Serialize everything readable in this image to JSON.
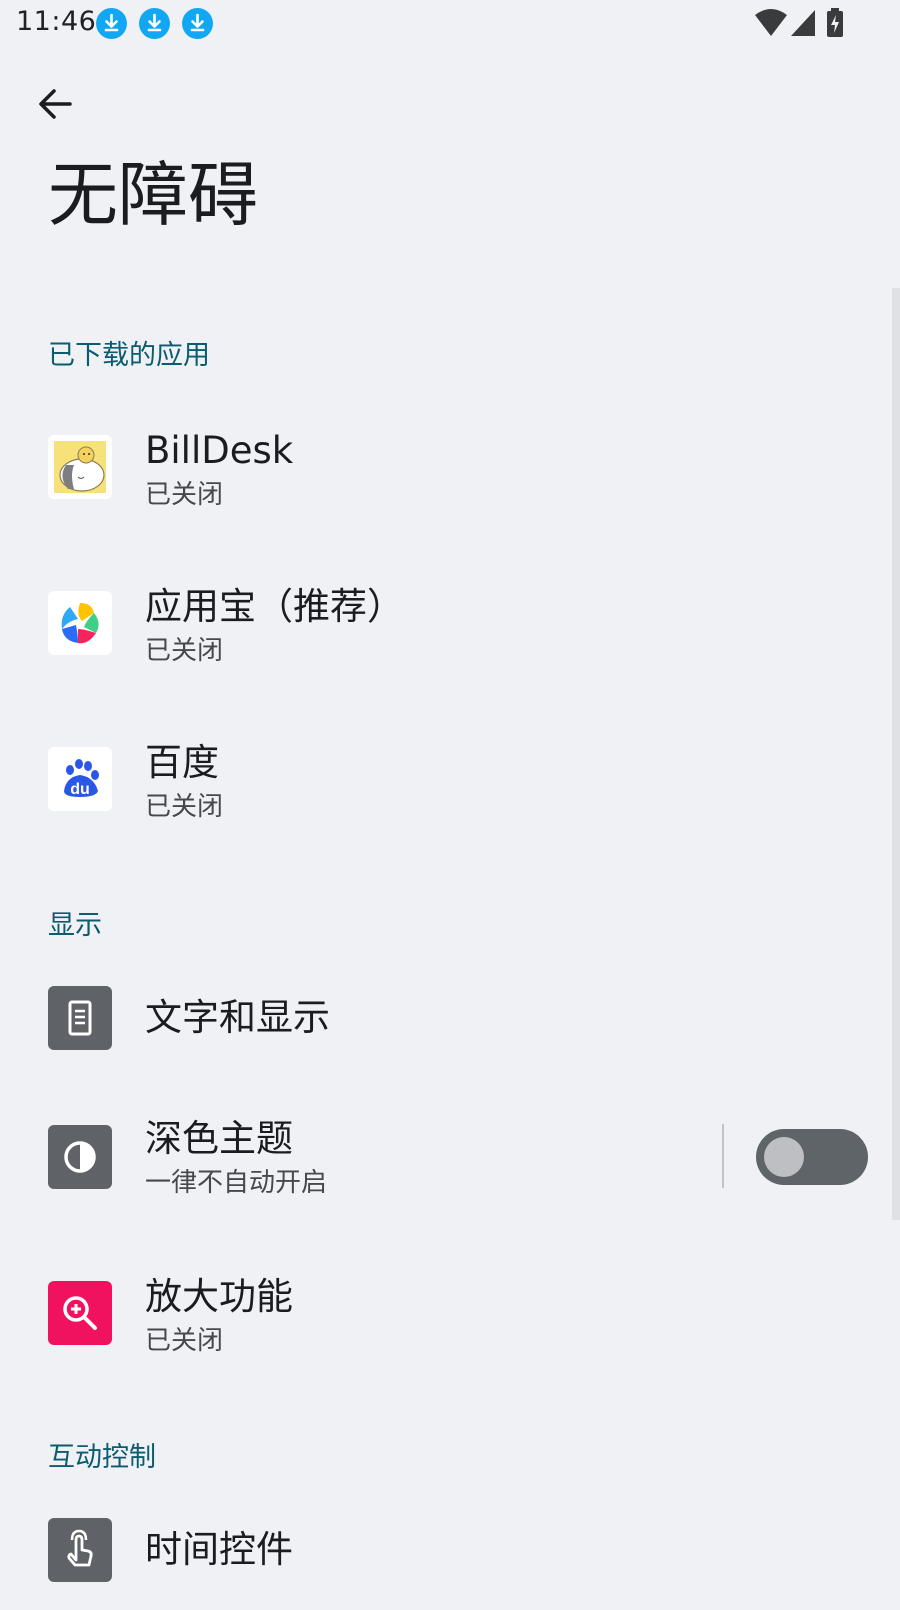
{
  "status_bar": {
    "time": "11:46",
    "notification_icons": [
      "download-icon",
      "download-icon",
      "download-icon"
    ],
    "right_icons": [
      "wifi-icon",
      "cellular-signal-icon",
      "battery-charging-icon"
    ]
  },
  "header": {
    "back_icon": "arrow-back-icon",
    "title": "无障碍"
  },
  "sections": {
    "downloaded": {
      "header": "已下载的应用",
      "items": [
        {
          "title": "BillDesk",
          "subtitle": "已关闭",
          "icon": "billdesk-app-icon"
        },
        {
          "title": "应用宝（推荐）",
          "subtitle": "已关闭",
          "icon": "yingyongbao-app-icon"
        },
        {
          "title": "百度",
          "subtitle": "已关闭",
          "icon": "baidu-app-icon"
        }
      ]
    },
    "display": {
      "header": "显示",
      "items": [
        {
          "title": "文字和显示",
          "icon": "text-display-icon"
        },
        {
          "title": "深色主题",
          "subtitle": "一律不自动开启",
          "icon": "dark-theme-icon",
          "toggle_on": false
        },
        {
          "title": "放大功能",
          "subtitle": "已关闭",
          "icon": "magnification-icon"
        }
      ]
    },
    "interaction": {
      "header": "互动控制",
      "items": [
        {
          "title": "时间控件",
          "icon": "touch-timing-icon"
        }
      ]
    }
  },
  "colors": {
    "background": "#eff1f5",
    "section_header": "#0b5c6f",
    "download_badge": "#12a7f2",
    "gray_icon_bg": "#5f6368",
    "magnifier_icon_bg": "#f0125e",
    "toggle_track_off": "#5f6468",
    "toggle_knob_off": "#bdbfc2"
  }
}
